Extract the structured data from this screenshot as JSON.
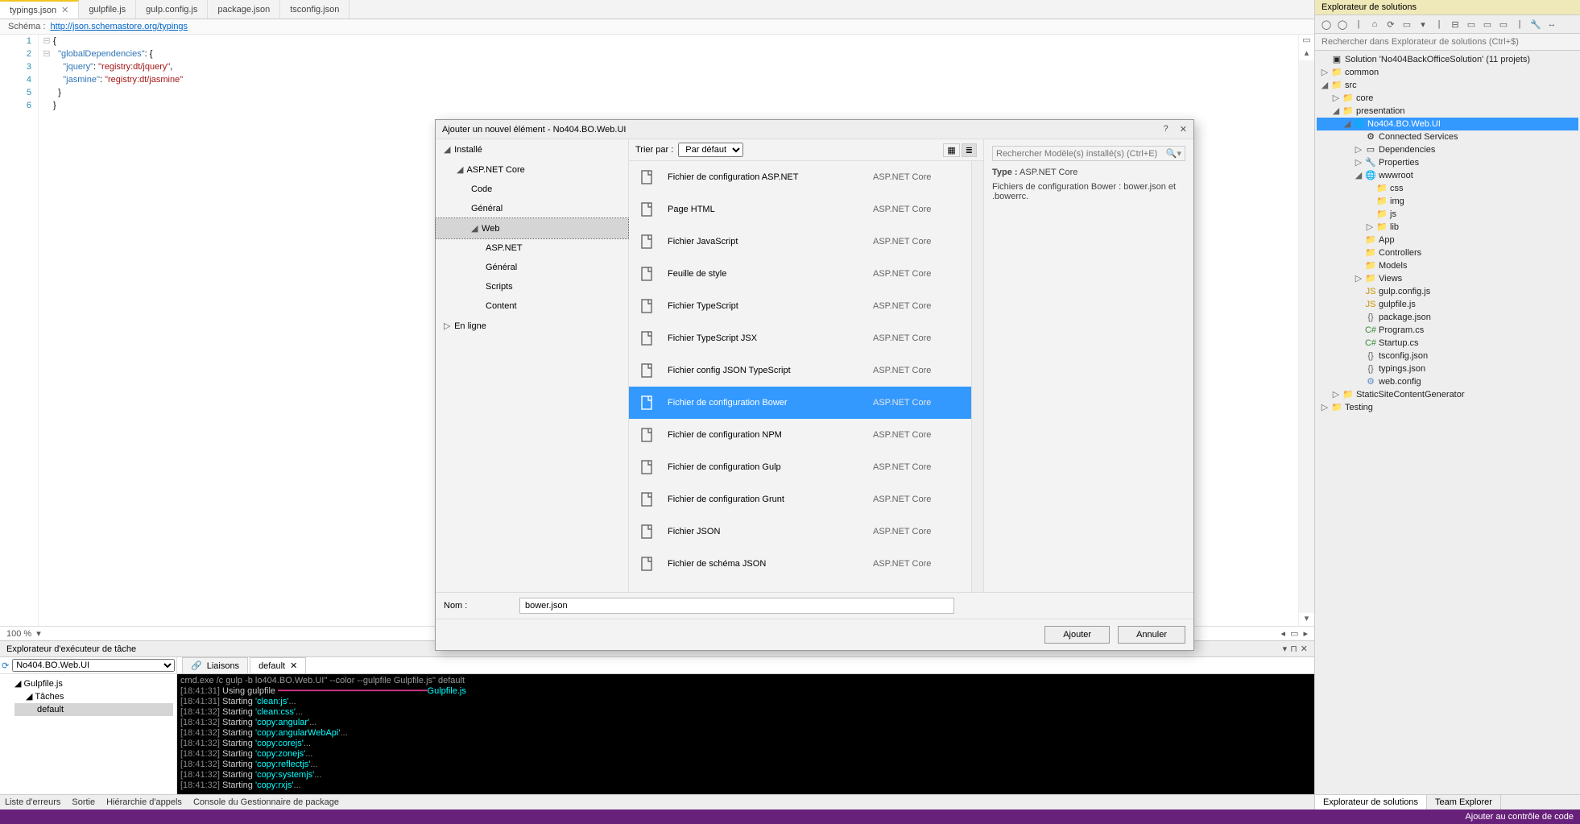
{
  "tabs": [
    {
      "label": "typings.json",
      "active": true,
      "closable": true
    },
    {
      "label": "gulpfile.js"
    },
    {
      "label": "gulp.config.js"
    },
    {
      "label": "package.json"
    },
    {
      "label": "tsconfig.json"
    }
  ],
  "schema": {
    "label": "Schéma :",
    "url": "http://json.schemastore.org/typings"
  },
  "code": {
    "lines": [
      "{",
      "  \"globalDependencies\": {",
      "    \"jquery\": \"registry:dt/jquery\",",
      "    \"jasmine\": \"registry:dt/jasmine\"",
      "  }",
      "}"
    ]
  },
  "zoom": {
    "value": "100 %"
  },
  "task_runner": {
    "title": "Explorateur d'exécuteur de tâche",
    "project": "No404.BO.Web.UI",
    "tree": [
      {
        "label": "Gulpfile.js",
        "level": 0,
        "icon": "gulp"
      },
      {
        "label": "Tâches",
        "level": 1
      },
      {
        "label": "default",
        "level": 2,
        "selected": true
      }
    ],
    "tabs": [
      {
        "label": "Liaisons",
        "icon": "link"
      },
      {
        "label": "default",
        "closable": true,
        "active": true
      }
    ],
    "console_header": "cmd.exe /c gulp -b                                lo404.BO.Web.UI\" --color --gulpfile                         Gulpfile.js\" default",
    "console": [
      {
        "ts": "[18:41:31]",
        "text": "Using gulpfile",
        "task": "Gulpfile.js",
        "path": true
      },
      {
        "ts": "[18:41:31]",
        "text": "Starting",
        "task": "'clean:js'",
        "tail": "..."
      },
      {
        "ts": "[18:41:32]",
        "text": "Starting",
        "task": "'clean:css'",
        "tail": "..."
      },
      {
        "ts": "[18:41:32]",
        "text": "Starting",
        "task": "'copy:angular'",
        "tail": "..."
      },
      {
        "ts": "[18:41:32]",
        "text": "Starting",
        "task": "'copy:angularWebApi'",
        "tail": "..."
      },
      {
        "ts": "[18:41:32]",
        "text": "Starting",
        "task": "'copy:corejs'",
        "tail": "..."
      },
      {
        "ts": "[18:41:32]",
        "text": "Starting",
        "task": "'copy:zonejs'",
        "tail": "..."
      },
      {
        "ts": "[18:41:32]",
        "text": "Starting",
        "task": "'copy:reflectjs'",
        "tail": "..."
      },
      {
        "ts": "[18:41:32]",
        "text": "Starting",
        "task": "'copy:systemjs'",
        "tail": "..."
      },
      {
        "ts": "[18:41:32]",
        "text": "Starting",
        "task": "'copy:rxjs'",
        "tail": "..."
      }
    ]
  },
  "bottom_tabs": [
    "Liste d'erreurs",
    "Sortie",
    "Hiérarchie d'appels",
    "Console du Gestionnaire de package"
  ],
  "status_right": "Ajouter au contrôle de code",
  "solution_explorer": {
    "title": "Explorateur de solutions",
    "search_placeholder": "Rechercher dans Explorateur de solutions (Ctrl+$)",
    "tree": [
      {
        "l": 0,
        "e": "",
        "ic": "sln",
        "t": "Solution 'No404BackOfficeSolution' (11 projets)"
      },
      {
        "l": 0,
        "e": "▷",
        "ic": "fold",
        "t": "common"
      },
      {
        "l": 0,
        "e": "◢",
        "ic": "fold",
        "t": "src"
      },
      {
        "l": 1,
        "e": "▷",
        "ic": "fold",
        "t": "core"
      },
      {
        "l": 1,
        "e": "◢",
        "ic": "fold",
        "t": "presentation"
      },
      {
        "l": 2,
        "e": "◢",
        "ic": "proj",
        "t": "No404.BO.Web.UI",
        "sel": true
      },
      {
        "l": 3,
        "e": "",
        "ic": "svc",
        "t": "Connected Services"
      },
      {
        "l": 3,
        "e": "▷",
        "ic": "ref",
        "t": "Dependencies"
      },
      {
        "l": 3,
        "e": "▷",
        "ic": "wrench",
        "t": "Properties"
      },
      {
        "l": 3,
        "e": "◢",
        "ic": "globe",
        "t": "wwwroot"
      },
      {
        "l": 4,
        "e": "",
        "ic": "fold",
        "t": "css"
      },
      {
        "l": 4,
        "e": "",
        "ic": "fold",
        "t": "img"
      },
      {
        "l": 4,
        "e": "",
        "ic": "fold",
        "t": "js"
      },
      {
        "l": 4,
        "e": "▷",
        "ic": "fold",
        "t": "lib"
      },
      {
        "l": 3,
        "e": "",
        "ic": "fold",
        "t": "App"
      },
      {
        "l": 3,
        "e": "",
        "ic": "fold",
        "t": "Controllers"
      },
      {
        "l": 3,
        "e": "",
        "ic": "fold",
        "t": "Models"
      },
      {
        "l": 3,
        "e": "▷",
        "ic": "fold",
        "t": "Views"
      },
      {
        "l": 3,
        "e": "",
        "ic": "js",
        "t": "gulp.config.js"
      },
      {
        "l": 3,
        "e": "",
        "ic": "js",
        "t": "gulpfile.js"
      },
      {
        "l": 3,
        "e": "",
        "ic": "json",
        "t": "package.json"
      },
      {
        "l": 3,
        "e": "",
        "ic": "cs",
        "t": "Program.cs"
      },
      {
        "l": 3,
        "e": "",
        "ic": "cs",
        "t": "Startup.cs"
      },
      {
        "l": 3,
        "e": "",
        "ic": "json",
        "t": "tsconfig.json"
      },
      {
        "l": 3,
        "e": "",
        "ic": "json",
        "t": "typings.json"
      },
      {
        "l": 3,
        "e": "",
        "ic": "cfg",
        "t": "web.config"
      },
      {
        "l": 1,
        "e": "▷",
        "ic": "fold",
        "t": "StaticSiteContentGenerator"
      },
      {
        "l": 0,
        "e": "▷",
        "ic": "fold",
        "t": "Testing"
      }
    ],
    "bottom": [
      {
        "label": "Explorateur de solutions",
        "active": true
      },
      {
        "label": "Team Explorer"
      }
    ]
  },
  "dialog": {
    "title": "Ajouter un nouvel élément - No404.BO.Web.UI",
    "left": {
      "installed": "Installé",
      "online": "En ligne",
      "tree": [
        {
          "label": "ASP.NET Core",
          "lvl": 1,
          "exp": true
        },
        {
          "label": "Code",
          "lvl": 2
        },
        {
          "label": "Général",
          "lvl": 2
        },
        {
          "label": "Web",
          "lvl": 2,
          "exp": true,
          "sel": true
        },
        {
          "label": "ASP.NET",
          "lvl": 3
        },
        {
          "label": "Général",
          "lvl": 3
        },
        {
          "label": "Scripts",
          "lvl": 3
        },
        {
          "label": "Content",
          "lvl": 3
        }
      ]
    },
    "sort": {
      "label": "Trier par :",
      "value": "Par défaut"
    },
    "search_placeholder": "Rechercher Modèle(s) installé(s) (Ctrl+E)",
    "items": [
      {
        "name": "Fichier de configuration ASP.NET",
        "cat": "ASP.NET Core"
      },
      {
        "name": "Page HTML",
        "cat": "ASP.NET Core"
      },
      {
        "name": "Fichier JavaScript",
        "cat": "ASP.NET Core"
      },
      {
        "name": "Feuille de style",
        "cat": "ASP.NET Core"
      },
      {
        "name": "Fichier TypeScript",
        "cat": "ASP.NET Core"
      },
      {
        "name": "Fichier TypeScript JSX",
        "cat": "ASP.NET Core"
      },
      {
        "name": "Fichier config JSON TypeScript",
        "cat": "ASP.NET Core"
      },
      {
        "name": "Fichier de configuration Bower",
        "cat": "ASP.NET Core",
        "sel": true
      },
      {
        "name": "Fichier de configuration NPM",
        "cat": "ASP.NET Core"
      },
      {
        "name": "Fichier de configuration Gulp",
        "cat": "ASP.NET Core"
      },
      {
        "name": "Fichier de configuration Grunt",
        "cat": "ASP.NET Core"
      },
      {
        "name": "Fichier JSON",
        "cat": "ASP.NET Core"
      },
      {
        "name": "Fichier de schéma JSON",
        "cat": "ASP.NET Core"
      }
    ],
    "detail": {
      "type_label": "Type :",
      "type": "ASP.NET Core",
      "desc": "Fichiers de configuration Bower : bower.json et .bowerrc."
    },
    "name": {
      "label": "Nom :",
      "value": "bower.json"
    },
    "buttons": {
      "add": "Ajouter",
      "cancel": "Annuler"
    }
  }
}
